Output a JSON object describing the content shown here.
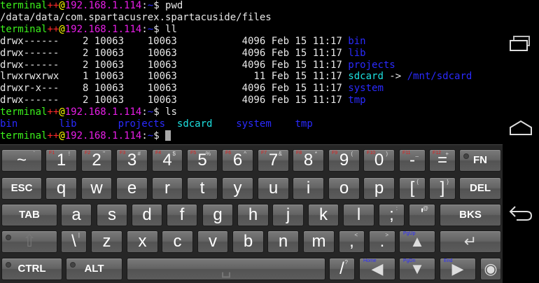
{
  "terminal": {
    "prompt": {
      "user": "terminal",
      "plus": "++",
      "at": "@",
      "host": "192.168.1.114",
      "colon": ":",
      "dir": "~",
      "dollar": "$"
    },
    "cmd1": "pwd",
    "pwd_output": "/data/data/com.spartacusrex.spartacuside/files",
    "cmd2": "ll",
    "ll_rows": [
      {
        "info": "drwx------    2 10063    10063           4096 Feb 15 11:17 ",
        "name": "bin"
      },
      {
        "info": "drwx------    2 10063    10063           4096 Feb 15 11:17 ",
        "name": "lib"
      },
      {
        "info": "drwx------    2 10063    10063           4096 Feb 15 11:17 ",
        "name": "projects"
      },
      {
        "info": "lrwxrwxrwx    1 10063    10063             11 Feb 15 11:17 ",
        "name": "sdcard",
        "arrow": " -> ",
        "target": "/mnt/sdcard"
      },
      {
        "info": "drwxr-x---    8 10063    10063           4096 Feb 15 11:17 ",
        "name": "system"
      },
      {
        "info": "drwx------    2 10063    10063           4096 Feb 15 11:17 ",
        "name": "tmp"
      }
    ],
    "cmd3": "ls",
    "ls_items": [
      "bin       ",
      "lib       ",
      "projects  ",
      "sdcard    ",
      "system    ",
      "tmp"
    ]
  },
  "keyboard": {
    "keys": [
      {
        "id": "tilde",
        "label": "~",
        "sup": "`"
      },
      {
        "id": "1",
        "label": "1",
        "fn": "F1",
        "sup": "!"
      },
      {
        "id": "2",
        "label": "2",
        "fn": "F2",
        "sup": "\""
      },
      {
        "id": "3",
        "label": "3",
        "fn": "F3",
        "sup": "#"
      },
      {
        "id": "4",
        "label": "4",
        "fn": "F4",
        "sup": "$"
      },
      {
        "id": "5",
        "label": "5",
        "fn": "F5",
        "sup": "%"
      },
      {
        "id": "6",
        "label": "6",
        "fn": "F6",
        "sup": "^"
      },
      {
        "id": "7",
        "label": "7",
        "fn": "F7",
        "sup": "&"
      },
      {
        "id": "8",
        "label": "8",
        "fn": "F8",
        "sup": "*"
      },
      {
        "id": "9",
        "label": "9",
        "fn": "F9",
        "sup": "("
      },
      {
        "id": "0",
        "label": "0",
        "fn": "F10",
        "sup": ")"
      },
      {
        "id": "minus",
        "label": "-",
        "fn": "F11",
        "sup": "_"
      },
      {
        "id": "equals",
        "label": "=",
        "fn": "F12",
        "sup": "+"
      },
      {
        "id": "fn",
        "label": "FN",
        "word": true,
        "led": true
      },
      {
        "id": "esc",
        "label": "ESC",
        "word": true
      },
      {
        "id": "q",
        "label": "q"
      },
      {
        "id": "w",
        "label": "w"
      },
      {
        "id": "e",
        "label": "e"
      },
      {
        "id": "r",
        "label": "r"
      },
      {
        "id": "t",
        "label": "t"
      },
      {
        "id": "y",
        "label": "y"
      },
      {
        "id": "u",
        "label": "u"
      },
      {
        "id": "i",
        "label": "i"
      },
      {
        "id": "o",
        "label": "o"
      },
      {
        "id": "p",
        "label": "p"
      },
      {
        "id": "lbracket",
        "label": "[",
        "sup": "{"
      },
      {
        "id": "rbracket",
        "label": "]",
        "sup": "}"
      },
      {
        "id": "del",
        "label": "DEL",
        "word": true
      },
      {
        "id": "tab",
        "label": "TAB",
        "word": true
      },
      {
        "id": "a",
        "label": "a"
      },
      {
        "id": "s",
        "label": "s"
      },
      {
        "id": "d",
        "label": "d"
      },
      {
        "id": "f",
        "label": "f"
      },
      {
        "id": "g",
        "label": "g"
      },
      {
        "id": "h",
        "label": "h"
      },
      {
        "id": "j",
        "label": "j"
      },
      {
        "id": "k",
        "label": "k"
      },
      {
        "id": "l",
        "label": "l"
      },
      {
        "id": "semicolon",
        "label": ";",
        "sup": ":"
      },
      {
        "id": "quote",
        "label": "'",
        "sup": "@"
      },
      {
        "id": "bks",
        "label": "BKS",
        "word": true
      },
      {
        "id": "shift",
        "label": "⇧",
        "led": true,
        "dim": true
      },
      {
        "id": "backslash",
        "label": "\\",
        "sup": "|"
      },
      {
        "id": "z",
        "label": "z"
      },
      {
        "id": "x",
        "label": "x"
      },
      {
        "id": "c",
        "label": "c"
      },
      {
        "id": "v",
        "label": "v"
      },
      {
        "id": "b",
        "label": "b"
      },
      {
        "id": "n",
        "label": "n"
      },
      {
        "id": "m",
        "label": "m"
      },
      {
        "id": "comma",
        "label": ",",
        "sup": "<"
      },
      {
        "id": "period",
        "label": ".",
        "sup": ">"
      },
      {
        "id": "up",
        "label": "▲",
        "nav": "PgUp",
        "arrow": true
      },
      {
        "id": "enter",
        "label": "↵",
        "arrow": true
      },
      {
        "id": "ctrl",
        "label": "CTRL",
        "word": true,
        "led": true
      },
      {
        "id": "alt",
        "label": "ALT",
        "word": true,
        "led": true
      },
      {
        "id": "space",
        "label": "␣",
        "dim": true
      },
      {
        "id": "slash",
        "label": "/",
        "sup": "?"
      },
      {
        "id": "left",
        "label": "◀",
        "nav": "Home",
        "arrow": true
      },
      {
        "id": "down",
        "label": "▼",
        "nav": "PgDn",
        "arrow": true
      },
      {
        "id": "right",
        "label": "▶",
        "nav": "End",
        "arrow": true
      },
      {
        "id": "settings",
        "label": "◉",
        "arrow": true
      }
    ]
  },
  "navbar": {
    "icons": [
      "recent-apps-icon",
      "home-icon",
      "back-icon"
    ]
  }
}
